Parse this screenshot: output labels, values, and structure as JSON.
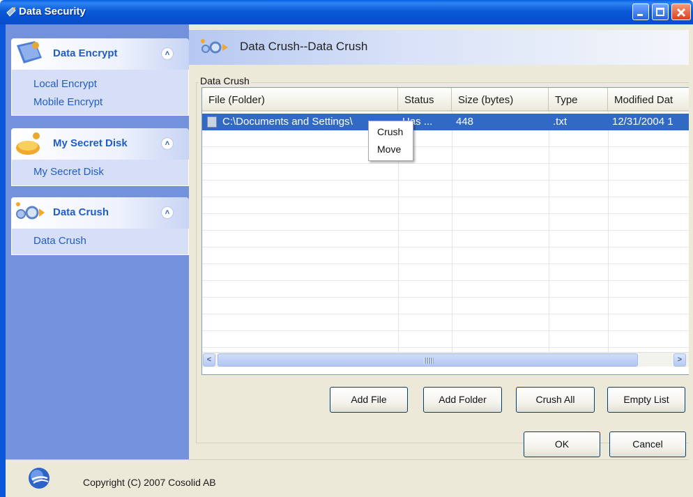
{
  "window": {
    "title": "Data Security",
    "controls": [
      "minimize",
      "maximize",
      "close"
    ]
  },
  "sidebar": {
    "groups": [
      {
        "title": "Data Encrypt",
        "icon": "data-encrypt-icon",
        "items": [
          "Local Encrypt",
          "Mobile Encrypt"
        ]
      },
      {
        "title": "My Secret Disk",
        "icon": "secret-disk-icon",
        "items": [
          "My Secret Disk"
        ]
      },
      {
        "title": "Data Crush",
        "icon": "data-crush-icon",
        "items": [
          "Data Crush"
        ]
      }
    ]
  },
  "main": {
    "header_title": "Data Crush--Data Crush",
    "groupbox_label": "Data Crush",
    "table": {
      "columns": [
        "File (Folder)",
        "Status",
        "Size (bytes)",
        "Type",
        "Modified Dat"
      ],
      "rows": [
        {
          "file": "C:\\Documents and Settings\\",
          "status": "Has ...",
          "size": "448",
          "type": ".txt",
          "modified": "12/31/2004 1"
        }
      ]
    },
    "context_menu": [
      "Crush",
      "Move"
    ],
    "action_buttons": {
      "add_file": "Add File",
      "add_folder": "Add Folder",
      "crush_all": "Crush All",
      "empty_list": "Empty List"
    },
    "dialog_buttons": {
      "ok": "OK",
      "cancel": "Cancel"
    }
  },
  "status_bar": {
    "copyright": "Copyright (C) 2007 Cosolid AB"
  },
  "colors": {
    "titlebar": "#0a5fe0",
    "sidebar_bg": "#7391dc",
    "sidebar_link": "#215dc6",
    "selection": "#316ac5",
    "dialog_bg": "#ece9d8"
  }
}
